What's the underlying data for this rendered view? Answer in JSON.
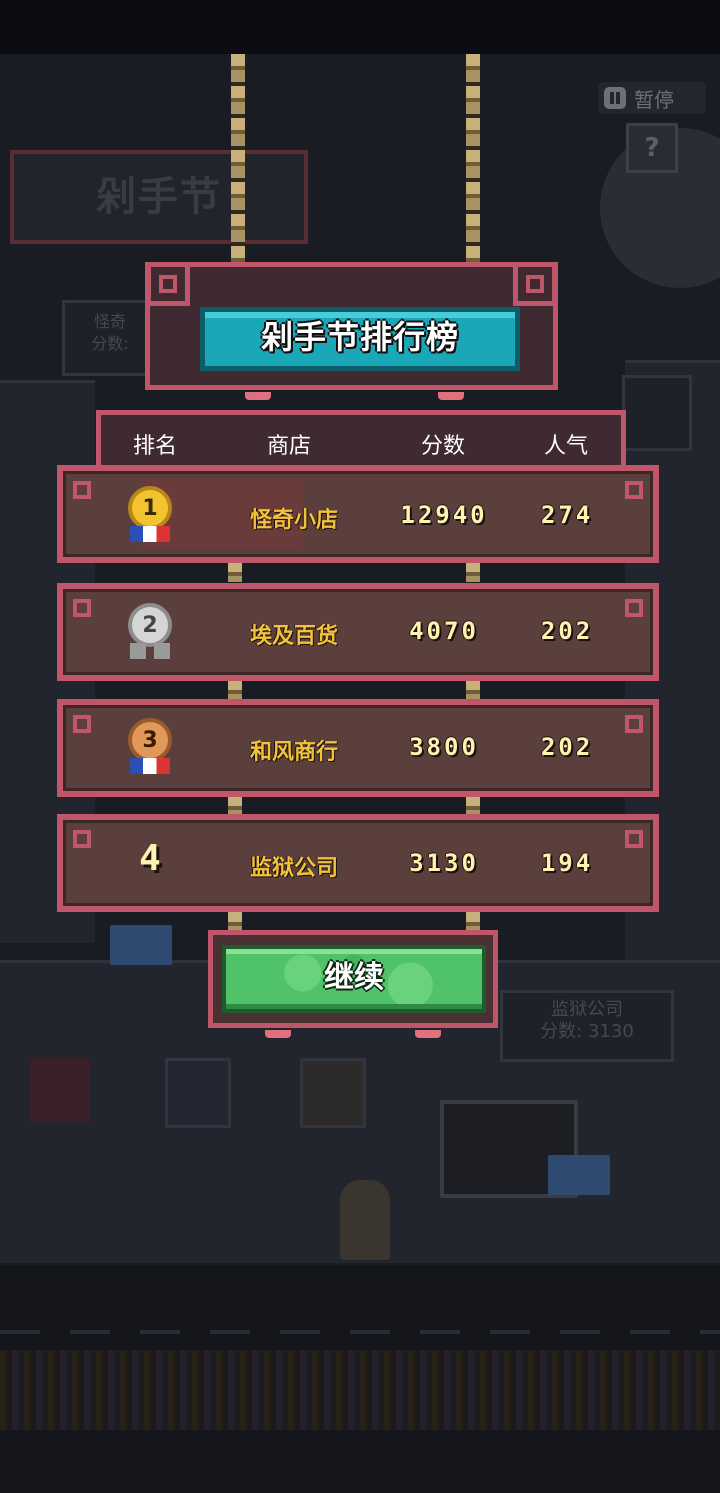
{
  "background": {
    "event_sign": "剁手节",
    "bg_rival_name": "怪奇",
    "bg_rival_score_label": "分数:",
    "bg_board_name": "监狱公司",
    "bg_board_score": "分数: 3130"
  },
  "controls": {
    "pause_label": "暂停",
    "help_label": "?"
  },
  "leaderboard": {
    "title": "剁手节排行榜",
    "headers": {
      "rank": "排名",
      "shop": "商店",
      "score": "分数",
      "popularity": "人气"
    },
    "rows": [
      {
        "rank": "1",
        "shop": "怪奇小店",
        "score": "12940",
        "popularity": "274",
        "medal": "gold"
      },
      {
        "rank": "2",
        "shop": "埃及百货",
        "score": "4070",
        "popularity": "202",
        "medal": "silver"
      },
      {
        "rank": "3",
        "shop": "和风商行",
        "score": "3800",
        "popularity": "202",
        "medal": "bronze"
      },
      {
        "rank": "4",
        "shop": "监狱公司",
        "score": "3130",
        "popularity": "194",
        "medal": "none"
      }
    ],
    "continue_label": "继续"
  },
  "colors": {
    "frame": "#c0566a",
    "title_bg": "#1aa8b8",
    "shop_text": "#f2c33a",
    "button": "#4fc26a"
  }
}
